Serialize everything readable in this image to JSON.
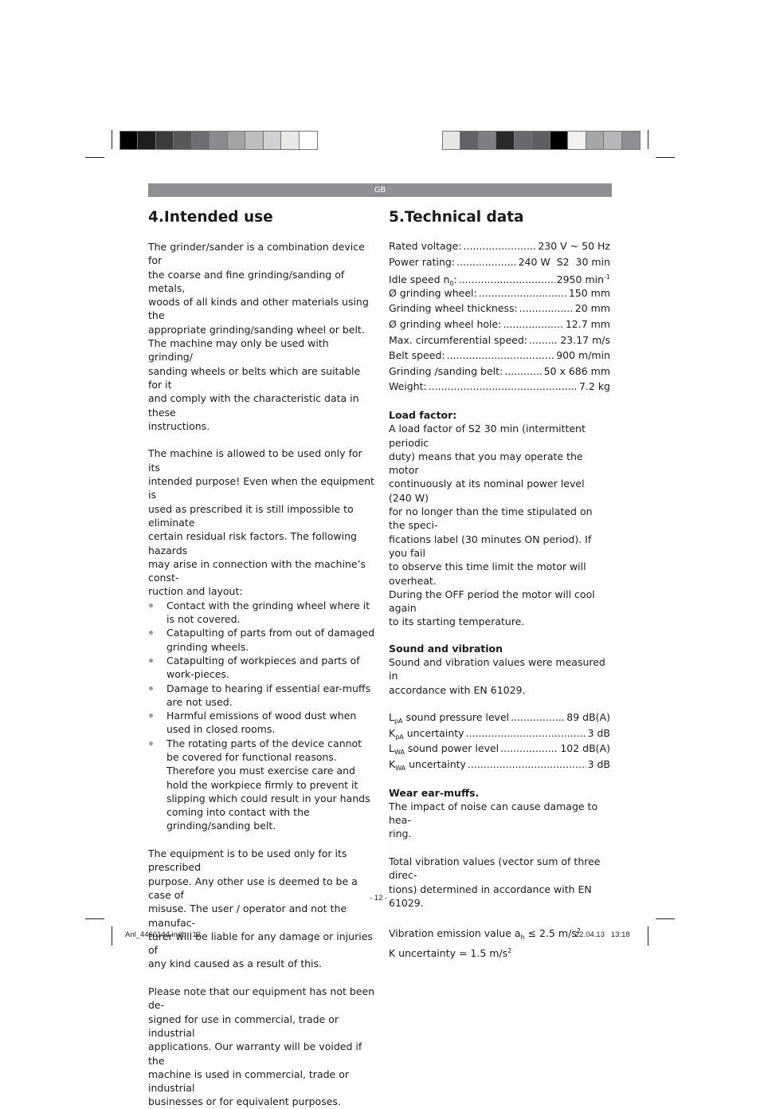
{
  "print_marks": {
    "left_swatches": [
      "#000000",
      "#1f1e1c",
      "#3c3c3e",
      "#57585a",
      "#6d6e71",
      "#8a8b8e",
      "#a2a3a5",
      "#bcbdbf",
      "#d0d1d2",
      "#e8e8e7",
      "#ffffff"
    ],
    "right_swatches": [
      "#e6e6e5",
      "#626366",
      "#7e7f82",
      "#2a2a2c",
      "#68696c",
      "#5e5f62",
      "#000000",
      "#f1f1f0",
      "#a5a6a8",
      "#b6b7b9",
      "#8d8e91"
    ]
  },
  "header": {
    "language": "GB"
  },
  "left": {
    "title": "4.Intended use",
    "paragraph1": [
      "The grinder/sander is a combination device for",
      "the coarse and fine grinding/sanding of metals,",
      "woods of all kinds and other materials using the",
      "appropriate grinding/sanding wheel or belt.",
      "The machine may only be used with grinding/",
      "sanding wheels or belts which are suitable for it",
      "and comply with the characteristic data in these",
      "instructions."
    ],
    "paragraph2": [
      "The machine is allowed to be used only for its",
      "intended purpose! Even when the equipment is",
      "used as prescribed it is still impossible to eliminate",
      "certain residual risk factors. The following hazards",
      "may arise in connection with the machine’s cons­t-",
      "ruction and layout:"
    ],
    "hazards": [
      "Contact with the grinding wheel where it is not covered.",
      "Catapulting of parts from out of damaged grinding wheels.",
      "Catapulting of workpieces and parts of work-pieces.",
      "Damage to hearing if essential ear-muffs are not used.",
      "Harmful emissions of wood dust when used in closed rooms.",
      "The rotating parts of the device cannot be covered for functional reasons. Therefore you must exercise care and hold the workpiece firmly to prevent it slipping which could result in your hands coming into contact with the grinding/sanding belt."
    ],
    "paragraph3": [
      "The equipment is to be used only for its prescribed",
      "purpose. Any other use is deemed to be a case of",
      "misuse. The user / operator and not the manufac-",
      "turer will be liable for any damage or injuries of",
      "any kind caused as a result of this."
    ],
    "paragraph4": [
      "Please note that our equipment has not been de-",
      "signed for use in commercial, trade or industrial",
      "applications. Our warranty will be voided if the",
      "machine is used in commercial, trade or industrial",
      "businesses or for equivalent purposes."
    ]
  },
  "right": {
    "title": "5.Technical data",
    "specs": [
      {
        "label": "Rated voltage:",
        "value": "230 V ~ 50 Hz"
      },
      {
        "label": "Power rating:",
        "value": "240 W  S2  30 min"
      },
      {
        "label": "Idle speed n",
        "label_sub": "0",
        "label_suffix": ":",
        "value": "2950 min",
        "value_sup": "-1"
      },
      {
        "label": "Ø grinding wheel:",
        "value": "150 mm"
      },
      {
        "label": "Grinding wheel thickness:",
        "value": "20 mm"
      },
      {
        "label": "Ø grinding wheel hole:",
        "value": "12.7 mm"
      },
      {
        "label": "Max. circumferential speed:",
        "value": "23.17 m/s"
      },
      {
        "label": "Belt speed:",
        "value": "900 m/min"
      },
      {
        "label": "Grinding /sanding belt:",
        "value": "50 x 686 mm"
      },
      {
        "label": "Weight:",
        "value": "7.2 kg"
      }
    ],
    "load_factor": {
      "heading": "Load factor:",
      "text": [
        "A load factor of S2 30 min (intermittent periodic",
        "duty) means that you may operate the motor",
        "continuously at its nominal power level (240 W)",
        "for no longer than the time stipulated on the speci-",
        "fications label (30 minutes ON period). If you fail",
        "to observe this time limit the motor will overheat.",
        "During the OFF period the motor will cool again",
        "to its starting temperature."
      ]
    },
    "sound": {
      "heading": "Sound and vibration",
      "text": [
        "Sound and vibration values were measured in",
        "accordance with EN 61029."
      ],
      "values": [
        {
          "sym": "L",
          "sub": "pA",
          "label": "sound pressure level",
          "value": "89 dB(A)"
        },
        {
          "sym": "K",
          "sub": "pA",
          "label": "uncertainty",
          "value": "3 dB"
        },
        {
          "sym": "L",
          "sub": "WA",
          "label": "sound power level",
          "value": "102 dB(A)"
        },
        {
          "sym": "K",
          "sub": "WA",
          "label": "uncertainty",
          "value": "3 dB"
        }
      ]
    },
    "ear_muffs": {
      "heading": "Wear ear-muffs.",
      "text": [
        "The impact of noise can cause damage to hea-",
        "ring."
      ],
      "text2": [
        "Total vibration values (vector sum of three direc-",
        "tions) determined in accordance with EN 61029."
      ],
      "vibration_prefix": "Vibration emission value a",
      "vibration_sub": "h",
      "vibration_value": " ≤ 2.5 m/s",
      "vibration_sup": "2",
      "uncertainty": "K uncertainty = 1.5 m/s",
      "uncertainty_sup": "2"
    }
  },
  "footer": {
    "page_number": "- 12 -",
    "file": "Anl_4466144.indb   12",
    "datetime": "22.04.13   13:18"
  }
}
